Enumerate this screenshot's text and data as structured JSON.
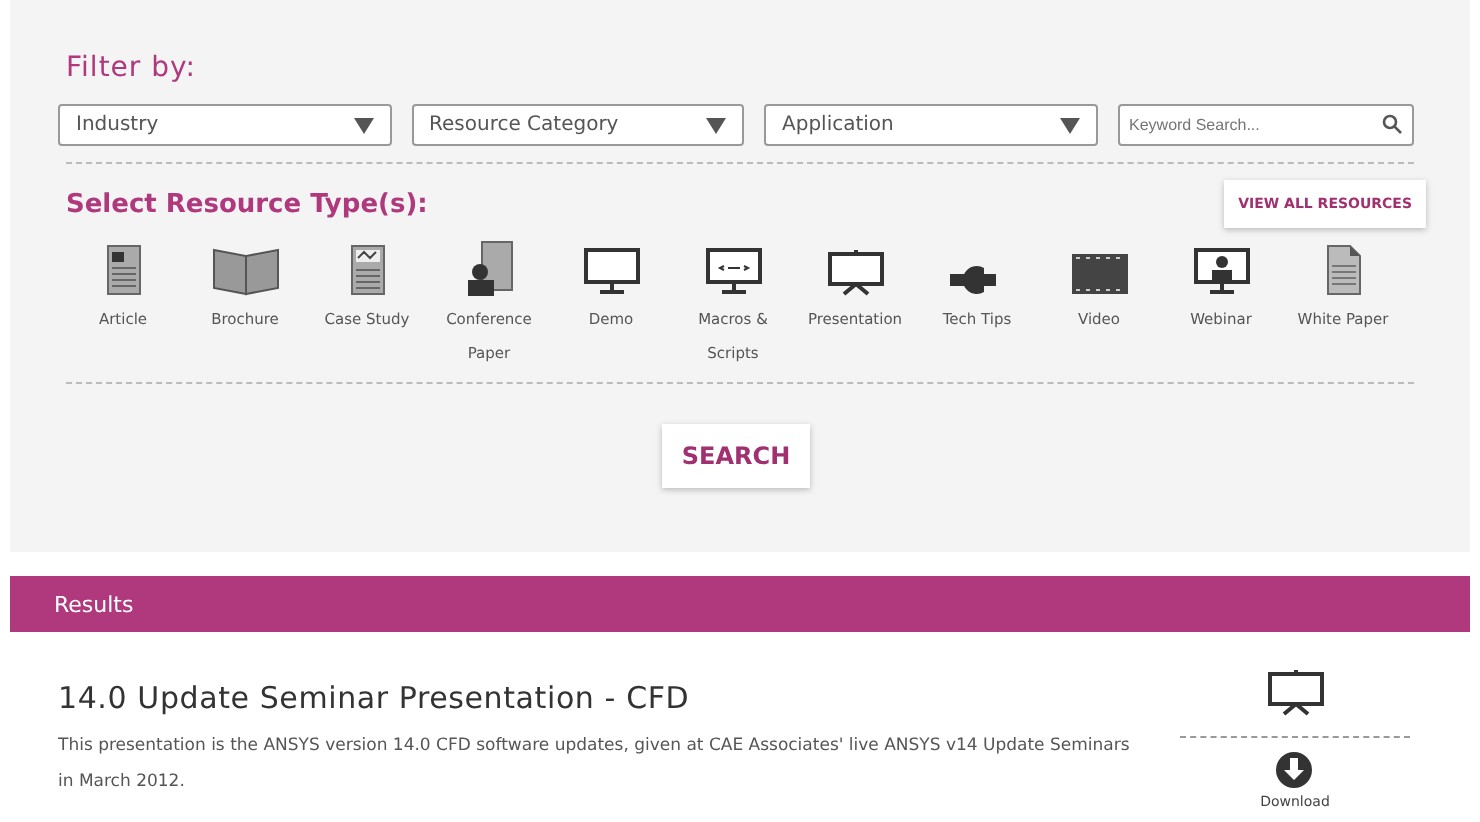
{
  "filter": {
    "heading": "Filter by:",
    "dropdowns": [
      {
        "label": "Industry"
      },
      {
        "label": "Resource Category"
      },
      {
        "label": "Application"
      }
    ],
    "search": {
      "placeholder": "Keyword Search..."
    }
  },
  "resource_types": {
    "heading": "Select Resource Type(s):",
    "view_all": "VIEW ALL RESOURCES",
    "items": [
      {
        "label": "Article",
        "kind": "article"
      },
      {
        "label": "Brochure",
        "kind": "brochure"
      },
      {
        "label": "Case Study",
        "kind": "casestudy"
      },
      {
        "label": "Conference Paper",
        "kind": "conference"
      },
      {
        "label": "Demo",
        "kind": "demo"
      },
      {
        "label": "Macros & Scripts",
        "kind": "macros"
      },
      {
        "label": "Presentation",
        "kind": "presentation"
      },
      {
        "label": "Tech Tips",
        "kind": "techtips"
      },
      {
        "label": "Video",
        "kind": "video"
      },
      {
        "label": "Webinar",
        "kind": "webinar"
      },
      {
        "label": "White Paper",
        "kind": "whitepaper"
      }
    ],
    "search_button": "SEARCH"
  },
  "results": {
    "heading": "Results",
    "items": [
      {
        "title": "14.0 Update Seminar Presentation - CFD",
        "description": "This presentation is the ANSYS version 14.0 CFD software updates, given at CAE Associates' live ANSYS v14 Update Seminars in March 2012.",
        "kind": "presentation",
        "download": "Download"
      }
    ]
  }
}
